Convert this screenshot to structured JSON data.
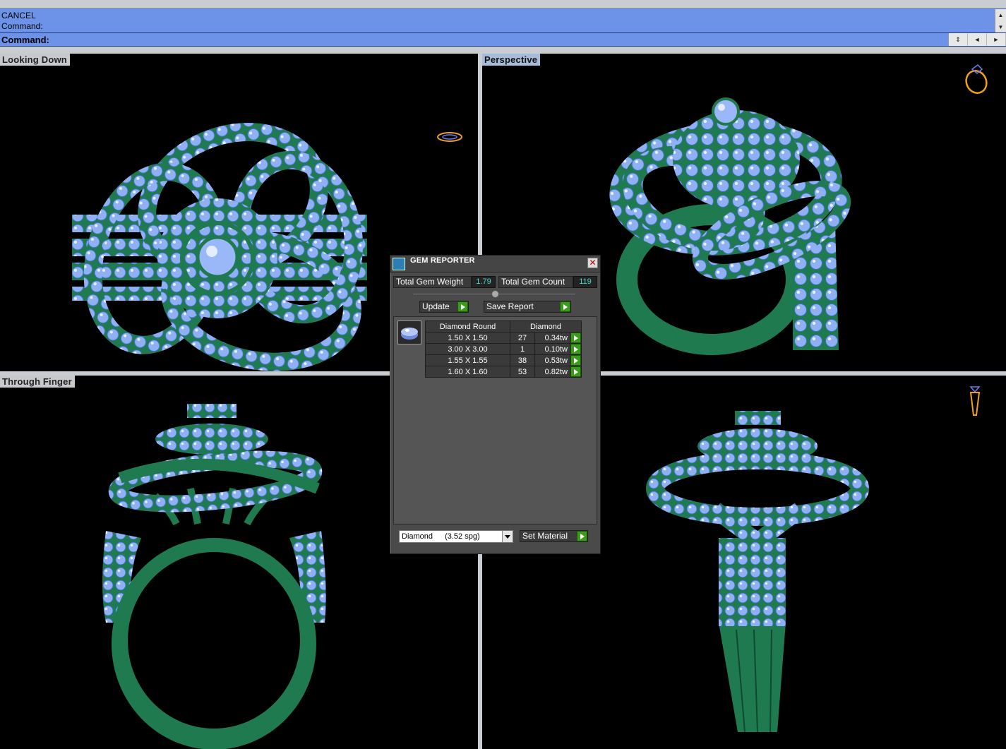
{
  "command_area": {
    "history": [
      "CANCEL",
      "Command:"
    ],
    "prompt_label": "Command:"
  },
  "viewports": {
    "top": {
      "label": "Looking Down"
    },
    "perspective": {
      "label": "Perspective"
    },
    "front": {
      "label": "Through Finger"
    },
    "side": {
      "label": ""
    }
  },
  "gem_reporter": {
    "title": "GEM REPORTER",
    "total_weight_label": "Total Gem Weight",
    "total_weight_value": "1.79",
    "total_count_label": "Total Gem Count",
    "total_count_value": "119",
    "update_label": "Update",
    "save_report_label": "Save Report",
    "table": {
      "header_shape": "Diamond Round",
      "header_material": "Diamond",
      "rows": [
        {
          "size": "1.50 X 1.50",
          "count": "27",
          "weight": "0.34tw"
        },
        {
          "size": "3.00 X 3.00",
          "count": "1",
          "weight": "0.10tw"
        },
        {
          "size": "1.55 X 1.55",
          "count": "38",
          "weight": "0.53tw"
        },
        {
          "size": "1.60 X 1.60",
          "count": "53",
          "weight": "0.82tw"
        }
      ]
    },
    "material_select": {
      "name": "Diamond",
      "sg": "(3.52 spg)"
    },
    "set_material_label": "Set Material"
  },
  "colors": {
    "metal": "#1f7a50",
    "gem": "#8fb0f2",
    "viewport_bg": "#000000",
    "command_bar": "#6c93e8",
    "orient_icon": "#f0a11a"
  },
  "icons": [
    "ring-orientation-icon",
    "close-icon",
    "gem-icon",
    "dropdown-arrow-icon",
    "play-arrow-icon"
  ]
}
